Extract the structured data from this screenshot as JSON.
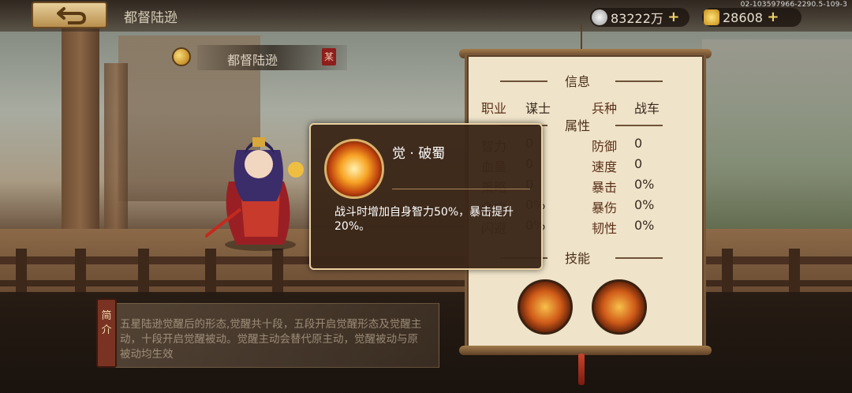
{
  "header": {
    "title": "都督陆逊",
    "build_info": "02-103597966-2290.5-109-3",
    "silver": "83222万",
    "gold": "28608",
    "plus_symbol": "+"
  },
  "hero": {
    "name": "都督陆逊",
    "seal": "某"
  },
  "info_panel": {
    "info_heading": "信息",
    "job_label": "职业",
    "job_value": "谋士",
    "troop_label": "兵种",
    "troop_value": "战车",
    "attr_heading": "属性",
    "attrs_left": [
      {
        "label": "智力",
        "value": "0"
      },
      {
        "label": "血量",
        "value": "0"
      },
      {
        "label": "策略",
        "value": "0"
      },
      {
        "label": "命中",
        "value": "0%"
      },
      {
        "label": "闪避",
        "value": "0%"
      }
    ],
    "attrs_right": [
      {
        "label": "防御",
        "value": "0"
      },
      {
        "label": "速度",
        "value": "0"
      },
      {
        "label": "暴击",
        "value": "0%"
      },
      {
        "label": "暴伤",
        "value": "0%"
      },
      {
        "label": "韧性",
        "value": "0%"
      }
    ],
    "skill_heading": "技能"
  },
  "tooltip": {
    "title": "觉 · 破蜀",
    "description": "战斗时增加自身智力50%，暴击提升20%。"
  },
  "bio": {
    "tag": "简介",
    "text": "五星陆逊觉醒后的形态,觉醒共十段，五段开启觉醒形态及觉醒主动，十段开启觉醒被动。觉醒主动会替代原主动，觉醒被动与原被动均生效"
  },
  "colors": {
    "tooltip_border": "#e9d1a2",
    "scroll_paper": "#efe3c9",
    "skill_fire": "#f7a324"
  }
}
